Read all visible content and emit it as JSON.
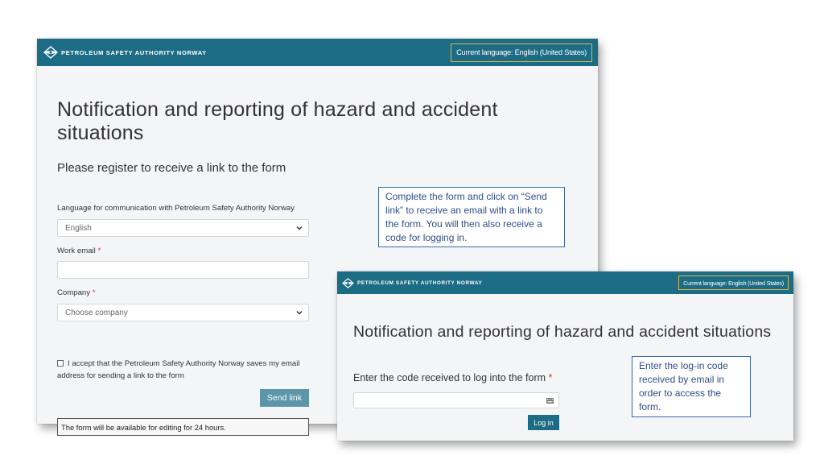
{
  "brand": {
    "name": "PETROLEUM SAFETY AUTHORITY NORWAY",
    "color": "#1c6c85"
  },
  "registration_window": {
    "language_badge": "Current language: English (United States)",
    "title": "Notification and reporting of hazard and accident situations",
    "subtitle": "Please register to receive a link to the form",
    "language_label": "Language for communication with Petroleum Safety Authority Norway",
    "language_value": "English",
    "email_label": "Work email",
    "email_value": "",
    "company_label": "Company",
    "company_placeholder": "Choose company",
    "required_marker": "*",
    "consent_text": "I accept that the Petroleum Safety Authority Norway saves my email address for sending a link to the form",
    "send_button": "Send link",
    "availability_notice": "The form will be available for editing for 24 hours."
  },
  "login_window": {
    "language_badge": "Current language: English (United States)",
    "title": "Notification and reporting of hazard and accident situations",
    "code_label": "Enter the code received to log into the form",
    "required_marker": "*",
    "code_value": "",
    "login_button": "Log in"
  },
  "callouts": {
    "registration": "Complete the form and click on “Send link” to receive an email with a link to the form. You will then also receive a code for logging in.",
    "login": "Enter the log-in code received by email in order to access the form."
  }
}
